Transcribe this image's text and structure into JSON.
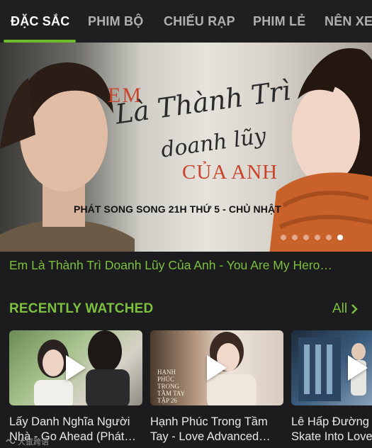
{
  "tabs": [
    {
      "label": "ĐẶC SẮC",
      "active": true
    },
    {
      "label": "PHIM BỘ",
      "active": false
    },
    {
      "label": "CHIẾU RẠP",
      "active": false
    },
    {
      "label": "PHIM LẺ",
      "active": false
    },
    {
      "label": "NÊN XE",
      "active": false
    }
  ],
  "banner": {
    "title_em": "EM",
    "title_script_1": "Là Thành Trì",
    "title_script_2": "doanh lũy",
    "title_cua": "CỦA ANH",
    "broadcast": "PHÁT SONG SONG 21H THỨ 5 - CHỦ NHẬT",
    "slide_count": 6,
    "active_slide": 6
  },
  "banner_caption": "Em Là Thành Trì Doanh Lũy Của Anh - You Are My Hero…",
  "recently_watched": {
    "title": "RECENTLY WATCHED",
    "see_all": "All",
    "items": [
      {
        "line1": "Lấy Danh Nghĩa Người",
        "line2": "Nhà - Go Ahead (Phát…",
        "thumb_overlay": ""
      },
      {
        "line1": "Hạnh Phúc Trong Tầm",
        "line2": "Tay - Love Advanced…",
        "thumb_overlay": "HẠNH PHÚC TRONG TẦM TAY TẬP 26"
      },
      {
        "line1": "Lê Hấp Đường",
        "line2": "Skate Into Love",
        "thumb_overlay": ""
      }
    ]
  },
  "watermark": "大鼠跨语",
  "colors": {
    "accent": "#7cc03d",
    "background": "#1c1c1e",
    "tab_bar": "#1f1f20"
  }
}
